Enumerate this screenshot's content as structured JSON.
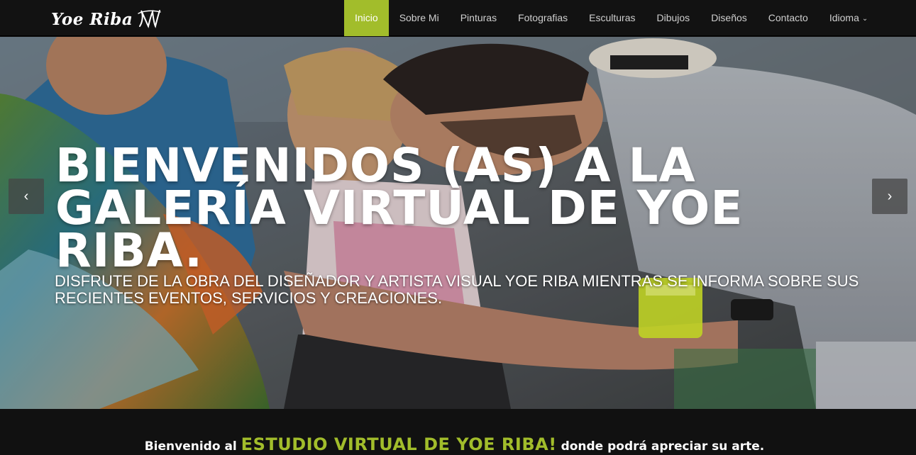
{
  "brand": {
    "name": "Yoe Riba",
    "logo_icon": "signature-logo-icon"
  },
  "nav": {
    "items": [
      {
        "label": "Inicio",
        "active": true
      },
      {
        "label": "Sobre Mi"
      },
      {
        "label": "Pinturas"
      },
      {
        "label": "Fotografias"
      },
      {
        "label": "Esculturas"
      },
      {
        "label": "Dibujos"
      },
      {
        "label": "Diseños"
      },
      {
        "label": "Contacto"
      },
      {
        "label": "Idioma",
        "dropdown": true
      }
    ],
    "active_color": "#a2bd2b"
  },
  "hero": {
    "title": "BIENVENIDOS (AS) A LA GALERÍA VIRTUAL DE YOE RIBA.",
    "subtitle": "DISFRUTE DE LA OBRA DEL DISEÑADOR Y ARTISTA VISUAL YOE RIBA MIENTRAS SE INFORMA SOBRE SUS RECIENTES EVENTOS, SERVICIOS Y CREACIONES.",
    "prev_icon": "chevron-left-icon",
    "next_icon": "chevron-right-icon",
    "prev_glyph": "‹",
    "next_glyph": "›"
  },
  "welcome": {
    "before": "Bienvenido al",
    "highlight": "ESTUDIO VIRTUAL DE YOE RIBA!",
    "after": "donde podrá apreciar su arte.",
    "highlight_color": "#a2bd2b"
  }
}
